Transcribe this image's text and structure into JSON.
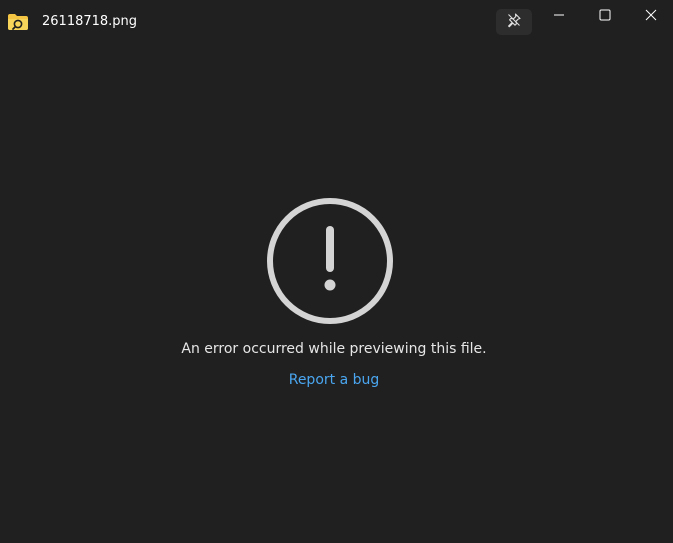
{
  "titlebar": {
    "file_name": "26118718.png",
    "icons": {
      "app": "folder-preview-icon",
      "pin": "unpin-icon",
      "minimize": "minimize-icon",
      "maximize": "maximize-icon",
      "close": "close-icon"
    }
  },
  "main": {
    "error_icon": "exclamation-circle-icon",
    "error_message": "An error occurred while previewing this file.",
    "report_link": "Report a bug"
  },
  "colors": {
    "background": "#202020",
    "link": "#4aa6f0",
    "icon_stroke": "#d4d4d4",
    "folder": "#f3c542"
  }
}
